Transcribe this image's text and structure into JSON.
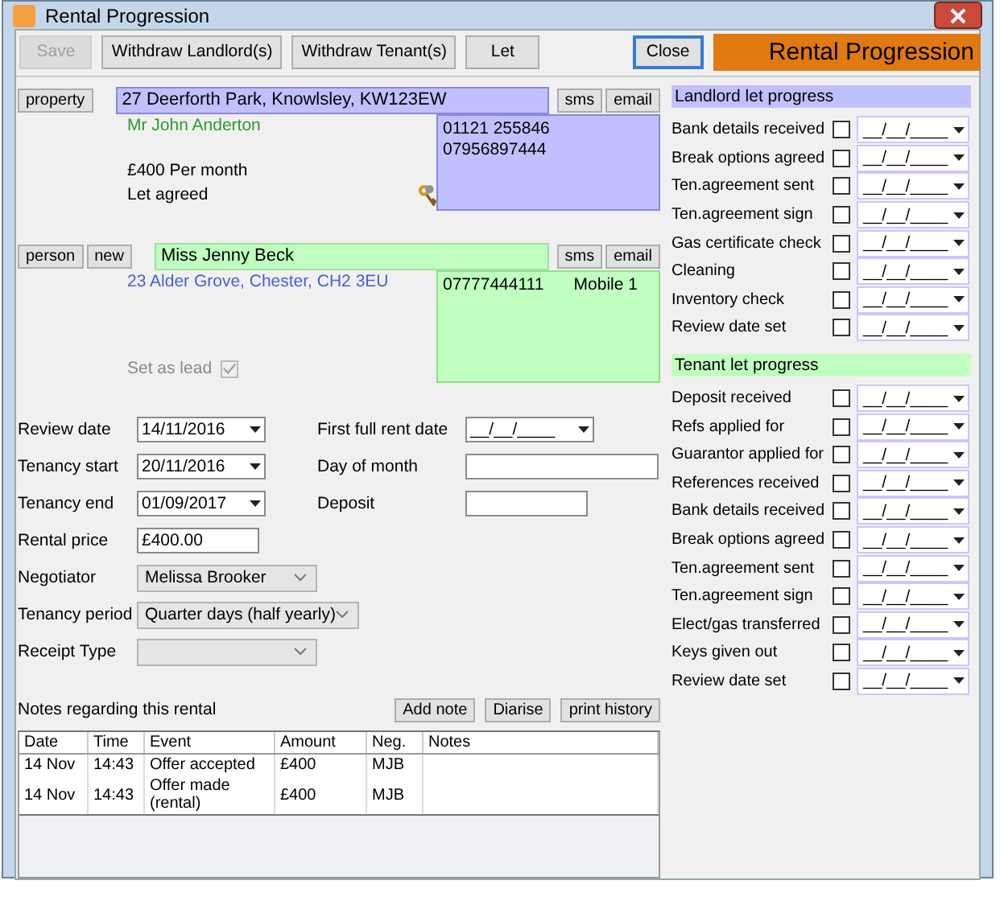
{
  "window": {
    "title": "Rental Progression"
  },
  "toolbar": {
    "buttons": [
      {
        "label": "Save",
        "disabled": true,
        "focused": false
      },
      {
        "label": "Withdraw Landlord(s)",
        "disabled": false,
        "focused": false
      },
      {
        "label": "Withdraw Tenant(s)",
        "disabled": false,
        "focused": false
      },
      {
        "label": "Let",
        "disabled": false,
        "focused": false
      },
      {
        "label": "Close",
        "disabled": false,
        "focused": true
      }
    ],
    "banner": "Rental Progression"
  },
  "property": {
    "button": "property",
    "address": "27 Deerforth Park, Knowlsley, KW123EW",
    "sms": "sms",
    "email": "email",
    "owner": "Mr John Anderton",
    "price": "£400 Per month",
    "status": "Let agreed",
    "phones": [
      "01121 255846",
      "07956897444"
    ]
  },
  "person": {
    "buttons": [
      "person",
      "new"
    ],
    "name": "Miss Jenny Beck",
    "sms": "sms",
    "email": "email",
    "address": "23 Alder Grove, Chester, CH2 3EU",
    "phone": "07777444111",
    "phone_label": "Mobile 1",
    "set_as_lead": {
      "label": "Set as lead",
      "checked": true,
      "disabled": true
    }
  },
  "left_fields": [
    {
      "label": "Review date",
      "value": "14/11/2016",
      "kind": "date"
    },
    {
      "label": "Tenancy start",
      "value": "20/11/2016",
      "kind": "date"
    },
    {
      "label": "Tenancy end",
      "value": "01/09/2017",
      "kind": "date"
    },
    {
      "label": "Rental price",
      "value": "£400.00",
      "kind": "text"
    },
    {
      "label": "Negotiator",
      "value": "Melissa Brooker",
      "kind": "select"
    },
    {
      "label": "Tenancy period",
      "value": "Quarter days (half yearly)",
      "kind": "select"
    },
    {
      "label": "Receipt Type",
      "kind": "select"
    }
  ],
  "right_fields": [
    {
      "label": "First full rent date",
      "value": "__/__/____",
      "kind": "date"
    },
    {
      "label": "Day of month",
      "kind": "wide"
    },
    {
      "label": "Deposit",
      "kind": "text"
    }
  ],
  "landlord_progress": {
    "title": "Landlord let progress",
    "items": [
      {
        "label": "Bank details received",
        "checked": false,
        "date": "__/__/____"
      },
      {
        "label": "Break options agreed",
        "checked": false,
        "date": "__/__/____"
      },
      {
        "label": "Ten.agreement sent",
        "checked": false,
        "date": "__/__/____"
      },
      {
        "label": "Ten.agreement sign",
        "checked": false,
        "date": "__/__/____"
      },
      {
        "label": "Gas certificate check",
        "checked": false,
        "date": "__/__/____"
      },
      {
        "label": "Cleaning",
        "checked": false,
        "date": "__/__/____"
      },
      {
        "label": "Inventory check",
        "checked": false,
        "date": "__/__/____"
      },
      {
        "label": "Review date set",
        "checked": false,
        "date": "__/__/____"
      }
    ]
  },
  "tenant_progress": {
    "title": "Tenant let progress",
    "items": [
      {
        "label": "Deposit received",
        "checked": false,
        "date": "__/__/____"
      },
      {
        "label": "Refs applied for",
        "checked": false,
        "date": "__/__/____"
      },
      {
        "label": "Guarantor applied for",
        "checked": false,
        "date": "__/__/____"
      },
      {
        "label": "References received",
        "checked": false,
        "date": "__/__/____"
      },
      {
        "label": "Bank details received",
        "checked": false,
        "date": "__/__/____"
      },
      {
        "label": "Break options agreed",
        "checked": false,
        "date": "__/__/____"
      },
      {
        "label": "Ten.agreement sent",
        "checked": false,
        "date": "__/__/____"
      },
      {
        "label": "Ten.agreement sign",
        "checked": false,
        "date": "__/__/____"
      },
      {
        "label": "Elect/gas transferred",
        "checked": false,
        "date": "__/__/____"
      },
      {
        "label": "Keys given out",
        "checked": false,
        "date": "__/__/____"
      },
      {
        "label": "Review date set",
        "checked": false,
        "date": "__/__/____"
      }
    ]
  },
  "notes": {
    "label": "Notes regarding this rental",
    "buttons": [
      "Add note",
      "Diarise",
      "print history"
    ],
    "columns": [
      "Date",
      "Time",
      "Event",
      "Amount",
      "Neg.",
      "Notes"
    ],
    "rows": [
      [
        "14 Nov",
        "14:43",
        "Offer accepted",
        "£400",
        "MJB",
        ""
      ],
      [
        "14 Nov",
        "14:43",
        "Offer made (rental)",
        "£400",
        "MJB",
        ""
      ]
    ]
  }
}
